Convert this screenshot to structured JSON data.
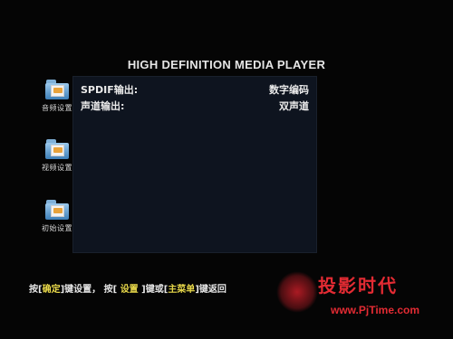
{
  "header": {
    "title": "HIGH DEFINITION MEDIA PLAYER"
  },
  "sidebar": {
    "items": [
      {
        "label": "音频设置",
        "icon": "audio-settings-folder-icon"
      },
      {
        "label": "视频设置",
        "icon": "video-settings-folder-icon"
      },
      {
        "label": "初始设置",
        "icon": "initial-settings-folder-icon"
      }
    ]
  },
  "settings": {
    "rows": [
      {
        "label": "SPDIF输出:",
        "value": "数字编码"
      },
      {
        "label": "声道输出:",
        "value": "双声道"
      }
    ]
  },
  "footer": {
    "hint_parts": [
      "按[",
      "确定",
      "]键设置， 按[ ",
      "设置",
      " ]键或[",
      "主菜单",
      "]键",
      "返回"
    ]
  },
  "watermark": {
    "title": "投影时代",
    "url": "www.PjTime.com"
  },
  "colors": {
    "background": "#050505",
    "panel": "#0e141f",
    "key_highlight": "#e9d94a",
    "watermark": "#e32b33"
  }
}
